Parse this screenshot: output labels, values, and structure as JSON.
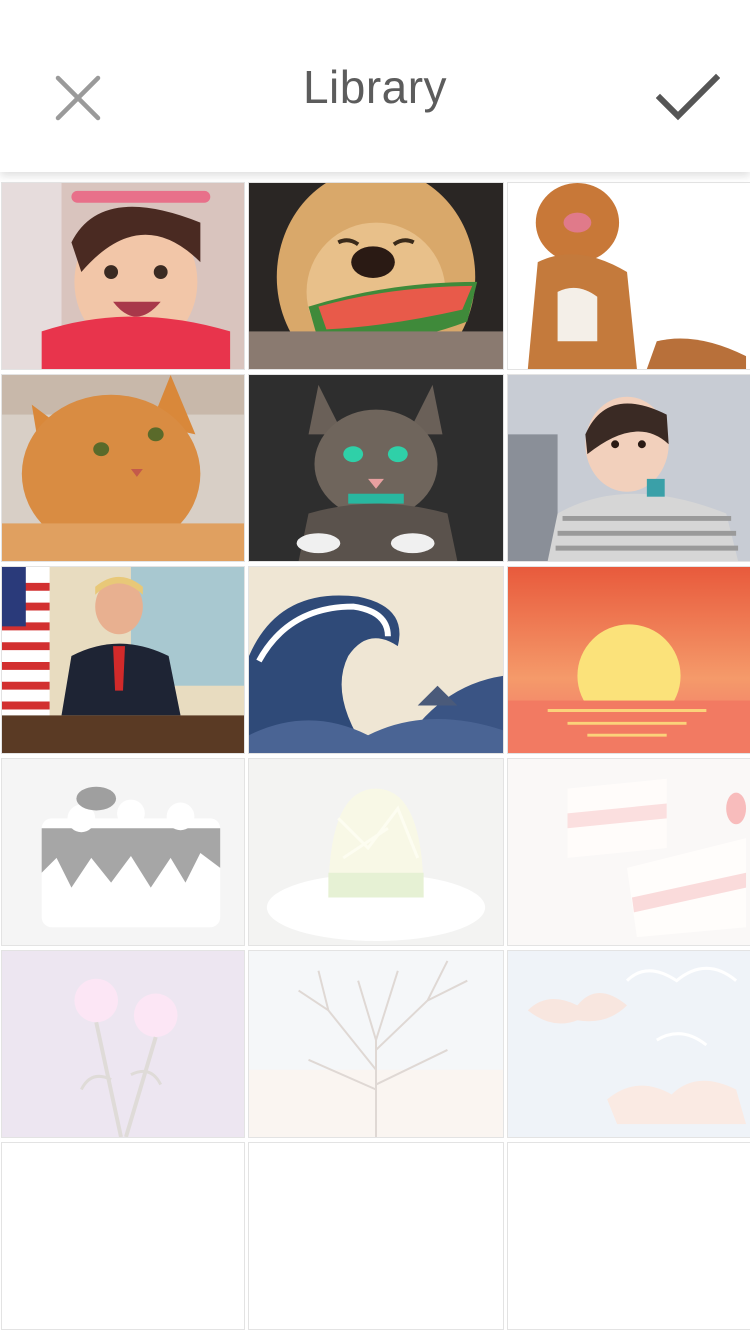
{
  "header": {
    "title": "Library",
    "close_icon": "close-icon",
    "confirm_icon": "checkmark-icon"
  },
  "colors": {
    "header_bg": "#ffffff",
    "icon_gray": "#5c5c5c",
    "close_gray": "#9a9a9a"
  },
  "photos": [
    {
      "name": "photo-baby-smiling",
      "state": "normal"
    },
    {
      "name": "photo-dog-watermelon",
      "state": "normal"
    },
    {
      "name": "photo-puppy",
      "state": "normal"
    },
    {
      "name": "photo-orange-cat",
      "state": "normal"
    },
    {
      "name": "photo-tabby-cat",
      "state": "normal"
    },
    {
      "name": "photo-baby-striped",
      "state": "normal"
    },
    {
      "name": "photo-man-desk",
      "state": "normal"
    },
    {
      "name": "photo-great-wave",
      "state": "normal"
    },
    {
      "name": "photo-sunset",
      "state": "normal"
    },
    {
      "name": "photo-drip-cake",
      "state": "faded"
    },
    {
      "name": "photo-dome-cake",
      "state": "faded"
    },
    {
      "name": "photo-strawberry-cake",
      "state": "faded"
    },
    {
      "name": "photo-pink-flowers",
      "state": "faded"
    },
    {
      "name": "photo-bare-tree",
      "state": "faded"
    },
    {
      "name": "photo-cloud-sky",
      "state": "faded"
    },
    {
      "name": "photo-empty",
      "state": "empty"
    },
    {
      "name": "photo-empty",
      "state": "empty"
    },
    {
      "name": "photo-empty",
      "state": "empty"
    }
  ]
}
